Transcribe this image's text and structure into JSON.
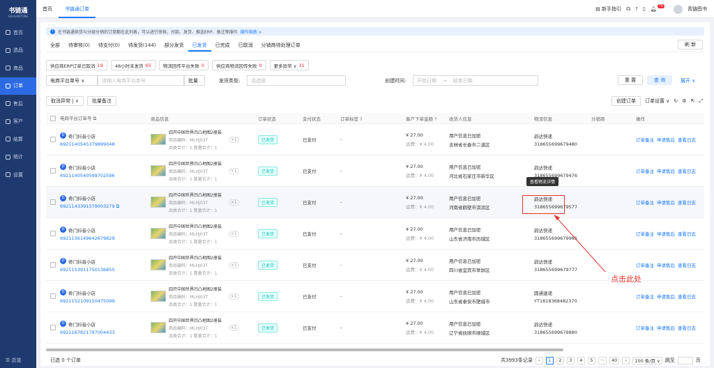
{
  "brand": {
    "name": "书链通",
    "sub": "SHULIANTONG"
  },
  "sidebar": {
    "items": [
      {
        "label": "首页",
        "icon": "home-icon"
      },
      {
        "label": "选品",
        "icon": "select-icon"
      },
      {
        "label": "商品",
        "icon": "goods-icon"
      },
      {
        "label": "订单",
        "icon": "order-icon",
        "active": true
      },
      {
        "label": "售后",
        "icon": "aftersale-icon"
      },
      {
        "label": "客户",
        "icon": "customer-icon"
      },
      {
        "label": "结算",
        "icon": "settle-icon"
      },
      {
        "label": "统计",
        "icon": "stats-icon"
      },
      {
        "label": "设置",
        "icon": "settings-icon"
      }
    ],
    "collapse_label": "☰ 总览"
  },
  "topbar": {
    "tabs": [
      "首页",
      "书链通订单"
    ],
    "guide": "新手指引",
    "badge": "70",
    "user": "青链图书"
  },
  "notice": {
    "text": "在书链通供货与分级分销的订单都在此列表，可以进行审核、付款、发货、推送ERP、备注等操作",
    "link": "操作指南 >"
  },
  "status_tabs": [
    "全部",
    "待审核(0)",
    "待支付(0)",
    "待发货(144)",
    "部分发货",
    "已发货",
    "已完成",
    "已取消",
    "分销商待处理订单"
  ],
  "active_status_tab": 5,
  "refresh_label": "刷 新",
  "chips": [
    {
      "label": "供应商ERP订单已取消",
      "count": "19"
    },
    {
      "label": "48小时未发货",
      "count": "65"
    },
    {
      "label": "物流回传平台失败",
      "count": "0"
    },
    {
      "label": "供应商物流回传失败",
      "count": "0"
    },
    {
      "label": "更多异常 ∨",
      "count": "31"
    }
  ],
  "filters": {
    "order_select": "电商平台单号 ∨",
    "order_placeholder": "请输入电商平台单号",
    "batch": "批量",
    "ship_type_label": "发货类型:",
    "ship_type_placeholder": "请选择",
    "created_label": "创建时间:",
    "start_date": "开始日期",
    "end_date": "结束日期",
    "reset": "重 置",
    "query": "查 询",
    "expand": "展开 ∨"
  },
  "actions": {
    "cancel_exception": "取消异常",
    "cancel_exception_more": "∨",
    "batch_remark": "批量备注",
    "create_order": "创建订单",
    "order_settings": "订单设置 ∨"
  },
  "columns": [
    "电商平台订单号 ⧉",
    "商品信息",
    "订单状态",
    "支付状态",
    "订单标签 ?",
    "客户下单金额 ?",
    "收货人信息",
    "物流信息",
    "分销商",
    "操作"
  ],
  "rows": [
    {
      "shop": "奇门抖音小店",
      "order": "6921140545379899048",
      "product": "四开中国世界凹凸地图2册装",
      "code": "商品编码：MLHJ03T",
      "counts": "品类合计：1    数量合计：1",
      "qty": "×1",
      "status": "已发货",
      "pay": "已支付",
      "tag": "-",
      "amount": "¥ 27.00",
      "freight": "运费：¥ 4.00",
      "recv1": "用户信息已加密",
      "recv2": "吉林省长春市二道区",
      "ship1": "韵达快递",
      "ship2": "318655699679480"
    },
    {
      "shop": "奇门抖音小店",
      "order": "6921140540599702596",
      "product": "四开中国世界凹凸地图2册装",
      "code": "商品编码：MLHJ03T",
      "counts": "品类合计：1    数量合计：1",
      "qty": "×1",
      "status": "已发货",
      "pay": "已支付",
      "tag": "-",
      "amount": "¥ 27.00",
      "freight": "运费：¥ 4.00",
      "recv1": "用户信息已加密",
      "recv2": "河北省石家庄市新华区",
      "ship1": "韵达快递",
      "ship2": "318655699679476"
    },
    {
      "shop": "奇门抖音小店",
      "order": "6921143391379003279 ⧉",
      "product": "四开中国世界凹凸地图2册装",
      "code": "商品编码：MLHJ03T",
      "counts": "品类合计：1    数量合计：1",
      "qty": "×1",
      "status": "已发货",
      "pay": "已支付",
      "tag": "-",
      "amount": "¥ 27.00",
      "freight": "运费：¥ 4.00",
      "recv1": "用户信息已加密",
      "recv2": "河南省鹤壁市淇滨区",
      "ship1": "韵达快递",
      "ship2": "318655699679577"
    },
    {
      "shop": "奇门抖音小店",
      "order": "6921136149642679829",
      "product": "四开中国世界凹凸地图2册装",
      "code": "商品编码：MLHJ03T",
      "counts": "品类合计：1    数量合计：1",
      "qty": "×1",
      "status": "已发货",
      "pay": "已支付",
      "tag": "-",
      "amount": "¥ 27.00",
      "freight": "运费：¥ 4.00",
      "recv1": "用户信息已加密",
      "recv2": "山东省济南市历城区",
      "ship1": "韵达快递",
      "ship2": "318655699679985"
    },
    {
      "shop": "奇门抖音小店",
      "order": "6921153911750136855",
      "product": "四开中国世界凹凸地图2册装",
      "code": "商品编码：MLHJ03T",
      "counts": "品类合计：1    数量合计：1",
      "qty": "×1",
      "status": "已发货",
      "pay": "已支付",
      "tag": "-",
      "amount": "¥ 27.00",
      "freight": "运费：¥ 4.00",
      "recv1": "用户信息已加密",
      "recv2": "四川省宜宾市翠屏区",
      "ship1": "韵达快递",
      "ship2": "318655699679777"
    },
    {
      "shop": "奇门抖音小店",
      "order": "6921152109150475099",
      "product": "四开中国世界凹凸地图2册装",
      "code": "商品编码：MLHJ03T",
      "counts": "品类合计：1    数量合计：1",
      "qty": "×1",
      "status": "已发货",
      "pay": "已支付",
      "tag": "-",
      "amount": "¥ 27.00",
      "freight": "运费：¥ 4.00",
      "recv1": "用户信息已加密",
      "recv2": "山东省泰安市肥城市",
      "ship1": "圆通速递",
      "ship2": "YT1818368482370"
    },
    {
      "shop": "奇门抖音小店",
      "order": "6921167821797004433",
      "product": "四开中国世界凹凸地图2册装",
      "code": "商品编码：MLHJ03T",
      "counts": "品类合计：1    数量合计：1",
      "qty": "×1",
      "status": "已发货",
      "pay": "已支付",
      "tag": "-",
      "amount": "¥ 27.00",
      "freight": "运费：¥ 4.00",
      "recv1": "用户信息已加密",
      "recv2": "辽宁省抚顺市顺城区",
      "ship1": "韵达快递",
      "ship2": "318655699679880"
    }
  ],
  "ops": [
    "订单备注",
    "申请售后",
    "查看日志"
  ],
  "tooltip": "查看物流详情",
  "annotation": "点击此处",
  "footer": {
    "selected": "已选  0 个订单",
    "total": "共3993条记录",
    "pages": [
      "1",
      "2",
      "3",
      "4",
      "5",
      "···",
      "40"
    ],
    "page_size": "100 条/页 ∨",
    "jump": "跳至",
    "page_unit": "页"
  }
}
